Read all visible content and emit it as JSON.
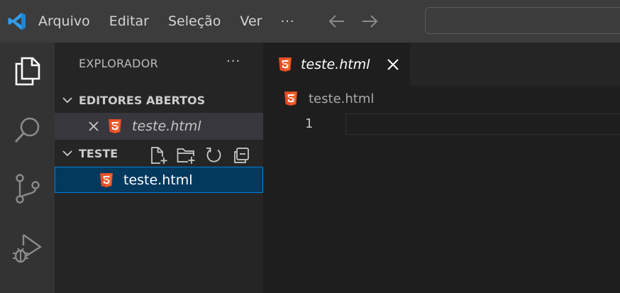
{
  "menu": {
    "file": "Arquivo",
    "edit": "Editar",
    "selection": "Seleção",
    "view": "Ver",
    "more": "···"
  },
  "sidebar": {
    "title": "EXPLORADOR",
    "more": "···",
    "open_editors": {
      "label": "EDITORES ABERTOS",
      "items": [
        {
          "name": "teste.html"
        }
      ]
    },
    "folder": {
      "label": "TESTE",
      "items": [
        {
          "name": "teste.html"
        }
      ]
    }
  },
  "tabs": [
    {
      "label": "teste.html"
    }
  ],
  "breadcrumb": {
    "file": "teste.html"
  },
  "editor": {
    "line_numbers": [
      "1"
    ]
  },
  "colors": {
    "accent_blue": "#0078d4",
    "html_icon": "#e44d26",
    "selection_bg": "#04395e",
    "selection_border": "#007fd4",
    "line_number": "#858585"
  }
}
